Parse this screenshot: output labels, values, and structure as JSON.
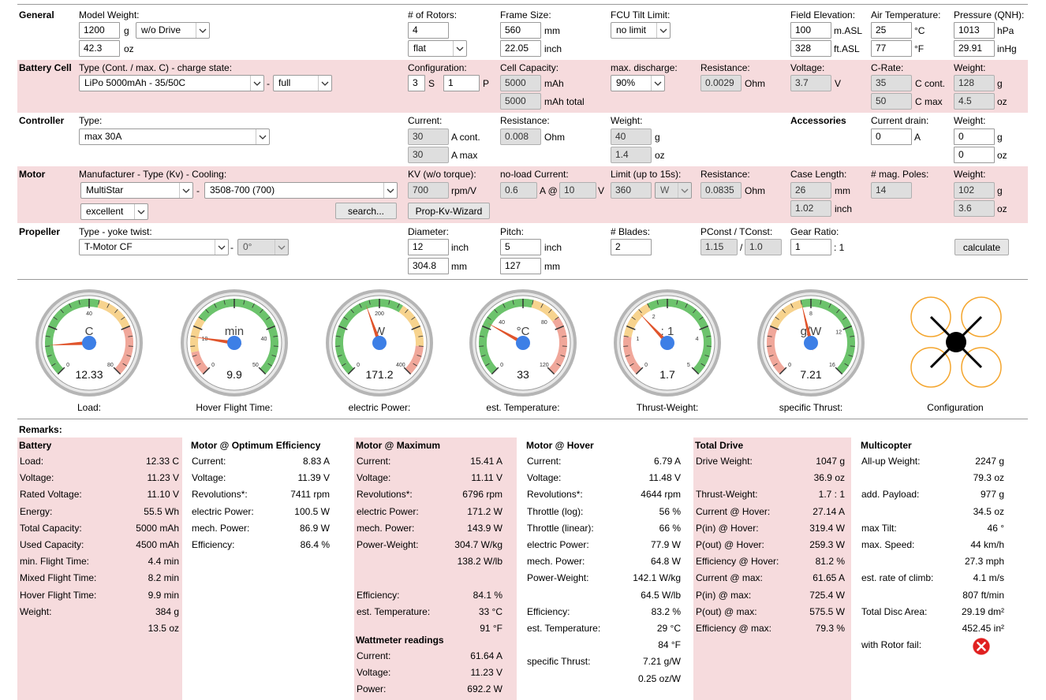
{
  "sections": {
    "general": "General",
    "battery": "Battery Cell",
    "controller": "Controller",
    "motor": "Motor",
    "propeller": "Propeller"
  },
  "general": {
    "model_weight_label": "Model Weight:",
    "weight_g": "1200",
    "unit_g": "g",
    "weight_oz": "42.3",
    "unit_oz": "oz",
    "drive_mode": "w/o Drive",
    "rotors_label": "# of Rotors:",
    "rotors": "4",
    "frame_type": "flat",
    "frame_size_label": "Frame Size:",
    "frame_mm": "560",
    "unit_mm": "mm",
    "frame_inch": "22.05",
    "unit_inch": "inch",
    "fcu_label": "FCU Tilt Limit:",
    "fcu_value": "no limit",
    "elev_label": "Field Elevation:",
    "elev_m": "100",
    "unit_masl": "m.ASL",
    "elev_ft": "328",
    "unit_ftasl": "ft.ASL",
    "air_label": "Air Temperature:",
    "air_c": "25",
    "unit_c": "°C",
    "air_f": "77",
    "unit_f": "°F",
    "press_label": "Pressure (QNH):",
    "press_hpa": "1013",
    "unit_hpa": "hPa",
    "press_inhg": "29.91",
    "unit_inhg": "inHg"
  },
  "battery": {
    "type_label": "Type (Cont. / max. C) - charge state:",
    "type": "LiPo 5000mAh - 35/50C",
    "dash": "-",
    "state": "full",
    "config_label": "Configuration:",
    "s": "3",
    "s_unit": "S",
    "p": "1",
    "p_unit": "P",
    "cap_label": "Cell Capacity:",
    "cap": "5000",
    "cap_unit": "mAh",
    "cap_total": "5000",
    "cap_total_unit": "mAh total",
    "disch_label": "max. discharge:",
    "disch": "90%",
    "res_label": "Resistance:",
    "res": "0.0029",
    "res_unit": "Ohm",
    "volt_label": "Voltage:",
    "volt": "3.7",
    "volt_unit": "V",
    "crate_label": "C-Rate:",
    "c_cont": "35",
    "c_cont_unit": "C cont.",
    "c_max": "50",
    "c_max_unit": "C max",
    "wt_label": "Weight:",
    "wt_g": "128",
    "wt_g_unit": "g",
    "wt_oz": "4.5",
    "wt_oz_unit": "oz"
  },
  "controller": {
    "type_label": "Type:",
    "type": "max 30A",
    "current_label": "Current:",
    "cur_cont": "30",
    "cur_cont_unit": "A cont.",
    "cur_max": "30",
    "cur_max_unit": "A max",
    "res_label": "Resistance:",
    "res": "0.008",
    "res_unit": "Ohm",
    "wt_label": "Weight:",
    "wt_g": "40",
    "wt_g_unit": "g",
    "wt_oz": "1.4",
    "wt_oz_unit": "oz",
    "acc_label": "Accessories",
    "drain_label": "Current drain:",
    "drain": "0",
    "drain_unit": "A",
    "acc_wt_label": "Weight:",
    "acc_wt_g": "0",
    "acc_wt_g_unit": "g",
    "acc_wt_oz": "0",
    "acc_wt_oz_unit": "oz"
  },
  "motor": {
    "mfr_label": "Manufacturer - Type (Kv) - Cooling:",
    "mfr": "MultiStar",
    "dash": "-",
    "type": "3508-700 (700)",
    "cooling": "excellent",
    "search": "search...",
    "kv_label": "KV (w/o torque):",
    "kv": "700",
    "kv_unit": "rpm/V",
    "wizard": "Prop-Kv-Wizard",
    "noload_label": "no-load Current:",
    "noload_a": "0.6",
    "noload_at": "A @",
    "noload_v": "10",
    "noload_v_unit": "V",
    "limit_label": "Limit (up to 15s):",
    "limit": "360",
    "limit_unit": "W",
    "res_label": "Resistance:",
    "res": "0.0835",
    "res_unit": "Ohm",
    "case_label": "Case Length:",
    "case_mm": "26",
    "case_mm_unit": "mm",
    "case_in": "1.02",
    "case_in_unit": "inch",
    "poles_label": "# mag. Poles:",
    "poles": "14",
    "wt_label": "Weight:",
    "wt_g": "102",
    "wt_g_unit": "g",
    "wt_oz": "3.6",
    "wt_oz_unit": "oz"
  },
  "propeller": {
    "type_label": "Type - yoke twist:",
    "type": "T-Motor CF",
    "dash": "-",
    "twist": "0°",
    "dia_label": "Diameter:",
    "dia_in": "12",
    "dia_in_unit": "inch",
    "dia_mm": "304.8",
    "dia_mm_unit": "mm",
    "pitch_label": "Pitch:",
    "pitch_in": "5",
    "pitch_in_unit": "inch",
    "pitch_mm": "127",
    "pitch_mm_unit": "mm",
    "blades_label": "# Blades:",
    "blades": "2",
    "pconst_label": "PConst / TConst:",
    "pconst": "1.15",
    "slash": "/",
    "tconst": "1.0",
    "gear_label": "Gear Ratio:",
    "gear": "1",
    "gear_unit": ": 1",
    "calculate": "calculate"
  },
  "gauges": [
    {
      "label": "Load:",
      "unit": "C",
      "value": "12.33",
      "v": 12.33,
      "min": 0,
      "max": 80,
      "ticks": [
        "0",
        "40",
        "80"
      ],
      "zones": [
        [
          "#6cc36c",
          0,
          0.55
        ],
        [
          "#f7d38e",
          0.55,
          0.75
        ],
        [
          "#f0a79a",
          0.75,
          1
        ]
      ]
    },
    {
      "label": "Hover Flight Time:",
      "unit": "min",
      "value": "9.9",
      "v": 9.9,
      "min": 0,
      "max": 50,
      "ticks": [
        "0",
        "10",
        "40",
        "50"
      ],
      "zones": [
        [
          "#f0a79a",
          0,
          0.12
        ],
        [
          "#f7d38e",
          0.12,
          0.3
        ],
        [
          "#6cc36c",
          0.3,
          1
        ]
      ]
    },
    {
      "label": "electric Power:",
      "unit": "W",
      "value": "171.2",
      "v": 171.2,
      "min": 0,
      "max": 400,
      "ticks": [
        "0",
        "200",
        "400"
      ],
      "zones": [
        [
          "#6cc36c",
          0,
          0.62
        ],
        [
          "#f7d38e",
          0.62,
          0.85
        ],
        [
          "#f0a79a",
          0.85,
          1
        ]
      ]
    },
    {
      "label": "est. Temperature:",
      "unit": "°C",
      "value": "33",
      "v": 33,
      "min": 0,
      "max": 120,
      "ticks": [
        "0",
        "40",
        "80",
        "120"
      ],
      "zones": [
        [
          "#6cc36c",
          0,
          0.55
        ],
        [
          "#f7d38e",
          0.55,
          0.7
        ],
        [
          "#f0a79a",
          0.7,
          1
        ]
      ]
    },
    {
      "label": "Thrust-Weight:",
      "unit": ": 1",
      "value": "1.7",
      "v": 1.7,
      "min": 0,
      "max": 5,
      "ticks": [
        "0",
        "1",
        "2",
        "4",
        "5"
      ],
      "zones": [
        [
          "#f0a79a",
          0,
          0.2
        ],
        [
          "#f7d38e",
          0.2,
          0.4
        ],
        [
          "#6cc36c",
          0.4,
          1
        ]
      ]
    },
    {
      "label": "specific Thrust:",
      "unit": "g/W",
      "value": "7.21",
      "v": 7.21,
      "min": 0,
      "max": 16,
      "ticks": [
        "0",
        "8",
        "12",
        "16"
      ],
      "zones": [
        [
          "#f0a79a",
          0,
          0.25
        ],
        [
          "#f7d38e",
          0.25,
          0.45
        ],
        [
          "#6cc36c",
          0.45,
          1
        ]
      ]
    }
  ],
  "configuration_label": "Configuration",
  "remarks_label": "Remarks:",
  "columns": [
    {
      "title": "Battery",
      "pink": true,
      "rows": [
        [
          "Load:",
          "12.33 C"
        ],
        [
          "Voltage:",
          "11.23 V"
        ],
        [
          "Rated Voltage:",
          "11.10 V"
        ],
        [
          "Energy:",
          "55.5 Wh"
        ],
        [
          "Total Capacity:",
          "5000 mAh"
        ],
        [
          "Used Capacity:",
          "4500 mAh"
        ],
        [
          "min. Flight Time:",
          "4.4 min"
        ],
        [
          "Mixed Flight Time:",
          "8.2 min"
        ],
        [
          "Hover Flight Time:",
          "9.9 min"
        ],
        [
          "Weight:",
          "384 g"
        ],
        [
          "",
          "13.5 oz"
        ]
      ]
    },
    {
      "title": "Motor @ Optimum Efficiency",
      "pink": false,
      "rows": [
        [
          "Current:",
          "8.83 A"
        ],
        [
          "Voltage:",
          "11.39 V"
        ],
        [
          "Revolutions*:",
          "7411 rpm"
        ],
        [
          "electric Power:",
          "100.5 W"
        ],
        [
          "mech. Power:",
          "86.9 W"
        ],
        [
          "Efficiency:",
          "86.4 %"
        ]
      ]
    },
    {
      "title": "Motor @ Maximum",
      "pink": true,
      "rows": [
        [
          "Current:",
          "15.41 A"
        ],
        [
          "Voltage:",
          "11.11 V"
        ],
        [
          "Revolutions*:",
          "6796 rpm"
        ],
        [
          "electric Power:",
          "171.2 W"
        ],
        [
          "mech. Power:",
          "143.9 W"
        ],
        [
          "Power-Weight:",
          "304.7 W/kg"
        ],
        [
          "",
          "138.2 W/lb"
        ],
        [
          "",
          ""
        ],
        [
          "Efficiency:",
          "84.1 %"
        ],
        [
          "est. Temperature:",
          "33 °C"
        ],
        [
          "",
          "91 °F"
        ]
      ],
      "sub_title": "Wattmeter readings",
      "sub_rows": [
        [
          "Current:",
          "61.64 A"
        ],
        [
          "Voltage:",
          "11.23 V"
        ],
        [
          "Power:",
          "692.2 W"
        ]
      ]
    },
    {
      "title": "Motor @ Hover",
      "pink": false,
      "rows": [
        [
          "Current:",
          "6.79 A"
        ],
        [
          "Voltage:",
          "11.48 V"
        ],
        [
          "Revolutions*:",
          "4644 rpm"
        ],
        [
          "Throttle (log):",
          "56 %"
        ],
        [
          "Throttle (linear):",
          "66 %"
        ],
        [
          "electric Power:",
          "77.9 W"
        ],
        [
          "mech. Power:",
          "64.8 W"
        ],
        [
          "Power-Weight:",
          "142.1 W/kg"
        ],
        [
          "",
          "64.5 W/lb"
        ],
        [
          "Efficiency:",
          "83.2 %"
        ],
        [
          "est. Temperature:",
          "29 °C"
        ],
        [
          "",
          "84 °F"
        ],
        [
          "specific Thrust:",
          "7.21 g/W"
        ],
        [
          "",
          "0.25 oz/W"
        ]
      ]
    },
    {
      "title": "Total Drive",
      "pink": true,
      "rows": [
        [
          "Drive Weight:",
          "1047 g"
        ],
        [
          "",
          "36.9 oz"
        ],
        [
          "Thrust-Weight:",
          "1.7 : 1"
        ],
        [
          "Current @ Hover:",
          "27.14 A"
        ],
        [
          "P(in) @ Hover:",
          "319.4 W"
        ],
        [
          "P(out) @ Hover:",
          "259.3 W"
        ],
        [
          "Efficiency @ Hover:",
          "81.2 %"
        ],
        [
          "Current @ max:",
          "61.65 A"
        ],
        [
          "P(in) @ max:",
          "725.4 W"
        ],
        [
          "P(out) @ max:",
          "575.5 W"
        ],
        [
          "Efficiency @ max:",
          "79.3 %"
        ]
      ]
    },
    {
      "title": "Multicopter",
      "pink": false,
      "rows": [
        [
          "All-up Weight:",
          "2247 g"
        ],
        [
          "",
          "79.3 oz"
        ],
        [
          "add. Payload:",
          "977 g"
        ],
        [
          "",
          "34.5 oz"
        ],
        [
          "max Tilt:",
          "46 °"
        ],
        [
          "max. Speed:",
          "44 km/h"
        ],
        [
          "",
          "27.3 mph"
        ],
        [
          "est. rate of climb:",
          "4.1 m/s"
        ],
        [
          "",
          "807 ft/min"
        ],
        [
          "Total Disc Area:",
          "29.19 dm²"
        ],
        [
          "",
          "452.45 in²"
        ],
        [
          "with Rotor fail:",
          ""
        ]
      ]
    }
  ]
}
